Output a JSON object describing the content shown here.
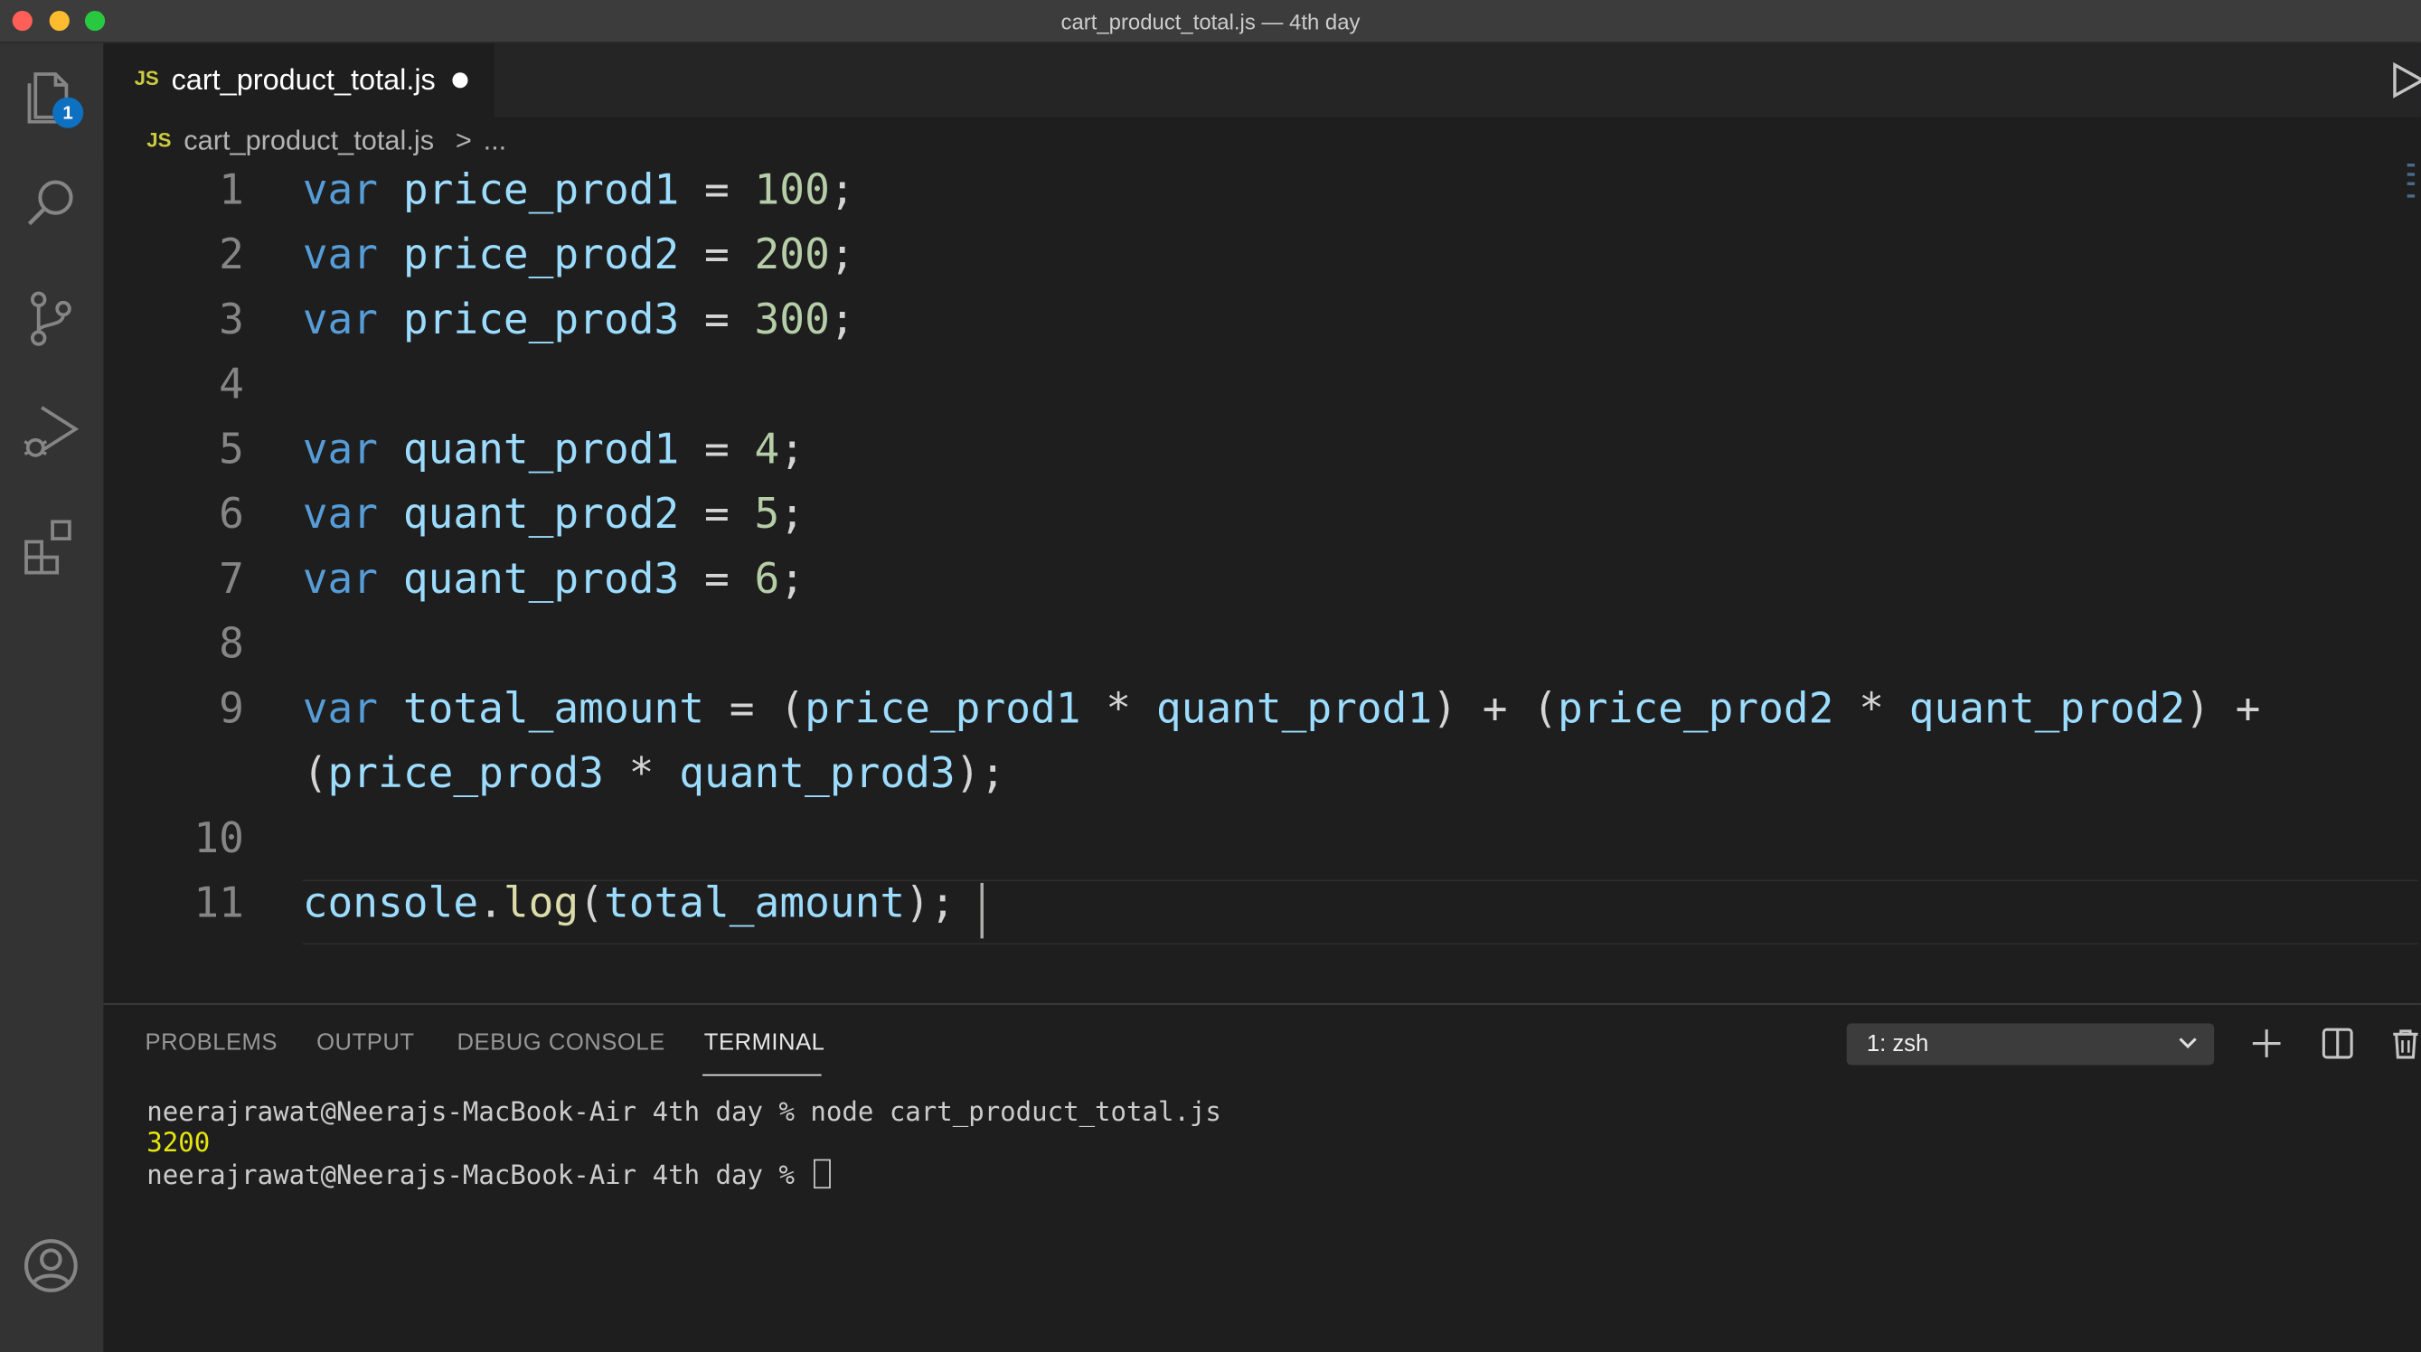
{
  "window": {
    "title": "cart_product_total.js — 4th day"
  },
  "activity_bar": {
    "explorer_badge": "1"
  },
  "tab": {
    "js_label": "JS",
    "filename": "cart_product_total.js"
  },
  "breadcrumb": {
    "js_label": "JS",
    "file": "cart_product_total.js",
    "separator": ">",
    "more": "..."
  },
  "code": {
    "line_numbers": [
      "1",
      "2",
      "3",
      "4",
      "5",
      "6",
      "7",
      "8",
      "9",
      "10",
      "11"
    ],
    "kw_var": "var",
    "l1": {
      "name": "price_prod1",
      "op": " = ",
      "value": "100",
      "end": ";"
    },
    "l2": {
      "name": "price_prod2",
      "op": " = ",
      "value": "200",
      "end": ";"
    },
    "l3": {
      "name": "price_prod3",
      "op": " = ",
      "value": "300",
      "end": ";"
    },
    "l5": {
      "name": "quant_prod1",
      "op": " = ",
      "value": "4",
      "end": ";"
    },
    "l6": {
      "name": "quant_prod2",
      "op": " = ",
      "value": "5",
      "end": ";"
    },
    "l7": {
      "name": "quant_prod3",
      "op": " = ",
      "value": "6",
      "end": ";"
    },
    "l9": {
      "name": "total_amount",
      "op": " = ",
      "p1": "(",
      "a1": "price_prod1",
      "m1": " * ",
      "b1": "quant_prod1",
      "c1": ") + ",
      "p2": "(",
      "a2": "price_prod2",
      "m2": " * ",
      "b2": "quant_prod2",
      "c2": ") +"
    },
    "l9b": {
      "p3": "(",
      "a3": "price_prod3",
      "m3": " * ",
      "b3": "quant_prod3",
      "c3": ");"
    },
    "l11": {
      "obj": "console",
      "dot": ".",
      "fn": "log",
      "open": "(",
      "arg": "total_amount",
      "close": ");"
    }
  },
  "panel": {
    "tabs": [
      "PROBLEMS",
      "OUTPUT",
      "DEBUG CONSOLE",
      "TERMINAL"
    ],
    "terminal_select": "1: zsh"
  },
  "terminal": {
    "line1": "neerajrawat@Neerajs-MacBook-Air 4th day % node cart_product_total.js",
    "line2": "3200",
    "line3": "neerajrawat@Neerajs-MacBook-Air 4th day % "
  },
  "colors": {
    "keyword": "#569cd6",
    "identifier": "#9cdcfe",
    "number": "#b5cea8",
    "function": "#dcdcaa",
    "badge": "#0e70c0"
  },
  "icons": [
    "explorer-icon",
    "search-icon",
    "source-control-icon",
    "run-debug-icon",
    "extensions-icon",
    "account-icon",
    "run-icon",
    "chevron-down-icon",
    "plus-icon",
    "split-icon",
    "trash-icon"
  ]
}
